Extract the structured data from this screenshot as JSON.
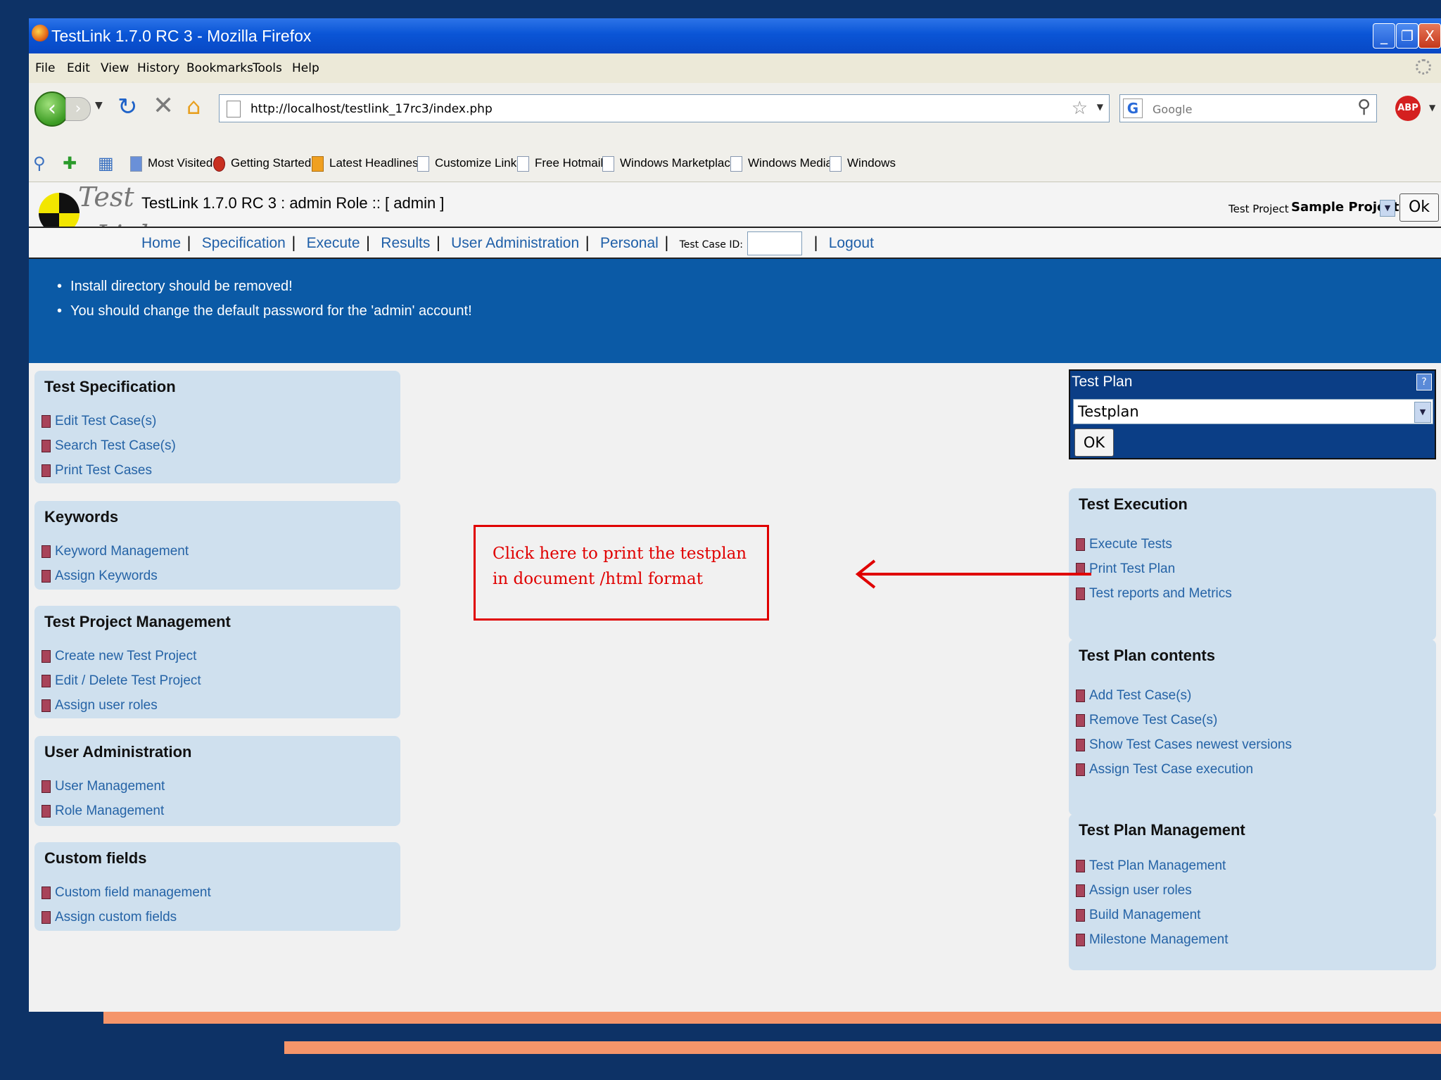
{
  "window": {
    "title": "TestLink 1.7.0 RC 3 - Mozilla Firefox",
    "minimize": "_",
    "restore": "❐",
    "close": "X"
  },
  "menu": [
    "File",
    "Edit",
    "View",
    "History",
    "Bookmarks",
    "Tools",
    "Help"
  ],
  "nav": {
    "url": "http://localhost/testlink_17rc3/index.php",
    "search_placeholder": "Google",
    "search_engine_letter": "G",
    "adblock_label": "ABP"
  },
  "bookmarks": [
    "Most Visited",
    "Getting Started",
    "Latest Headlines",
    "Customize Links",
    "Free Hotmail",
    "Windows Marketplace",
    "Windows Media",
    "Windows"
  ],
  "header": {
    "logo_top": "Test",
    "logo_bottom": "Link",
    "title": "TestLink 1.7.0 RC 3 : admin Role :: [ admin ]",
    "project_label": "Test Project",
    "project_value": "Sample Project",
    "ok": "Ok"
  },
  "topnav": {
    "items": [
      "Home",
      "Specification",
      "Execute",
      "Results",
      "User Administration",
      "Personal"
    ],
    "testcase_label": "Test Case ID:",
    "logout": "Logout"
  },
  "warnings": [
    "Install directory should be removed!",
    "You should change the default password for the 'admin' account!"
  ],
  "left_panels": [
    {
      "title": "Test Specification",
      "items": [
        "Edit Test Case(s)",
        "Search Test Case(s)",
        "Print Test Cases"
      ]
    },
    {
      "title": "Keywords",
      "items": [
        "Keyword Management",
        "Assign Keywords"
      ]
    },
    {
      "title": "Test Project Management",
      "items": [
        "Create new Test Project",
        "Edit / Delete Test Project",
        "Assign user roles"
      ]
    },
    {
      "title": "User Administration",
      "items": [
        "User Management",
        "Role Management"
      ]
    },
    {
      "title": "Custom fields",
      "items": [
        "Custom field management",
        "Assign custom fields"
      ]
    }
  ],
  "test_plan_box": {
    "label": "Test Plan",
    "help": "?",
    "selected": "Testplan",
    "ok": "OK"
  },
  "right_panels": [
    {
      "title": "Test Execution",
      "items": [
        "Execute Tests",
        "Print Test Plan",
        "Test reports and Metrics"
      ]
    },
    {
      "title": "Test Plan contents",
      "items": [
        "Add Test Case(s)",
        "Remove Test Case(s)",
        "Show Test Cases newest versions",
        "Assign Test Case execution"
      ]
    },
    {
      "title": "Test Plan Management",
      "items": [
        "Test Plan Management",
        "Assign user roles",
        "Build Management",
        "Milestone Management"
      ]
    }
  ],
  "callout": {
    "text": "Click here to print the testplan in document /html format",
    "color": "#e00000"
  }
}
